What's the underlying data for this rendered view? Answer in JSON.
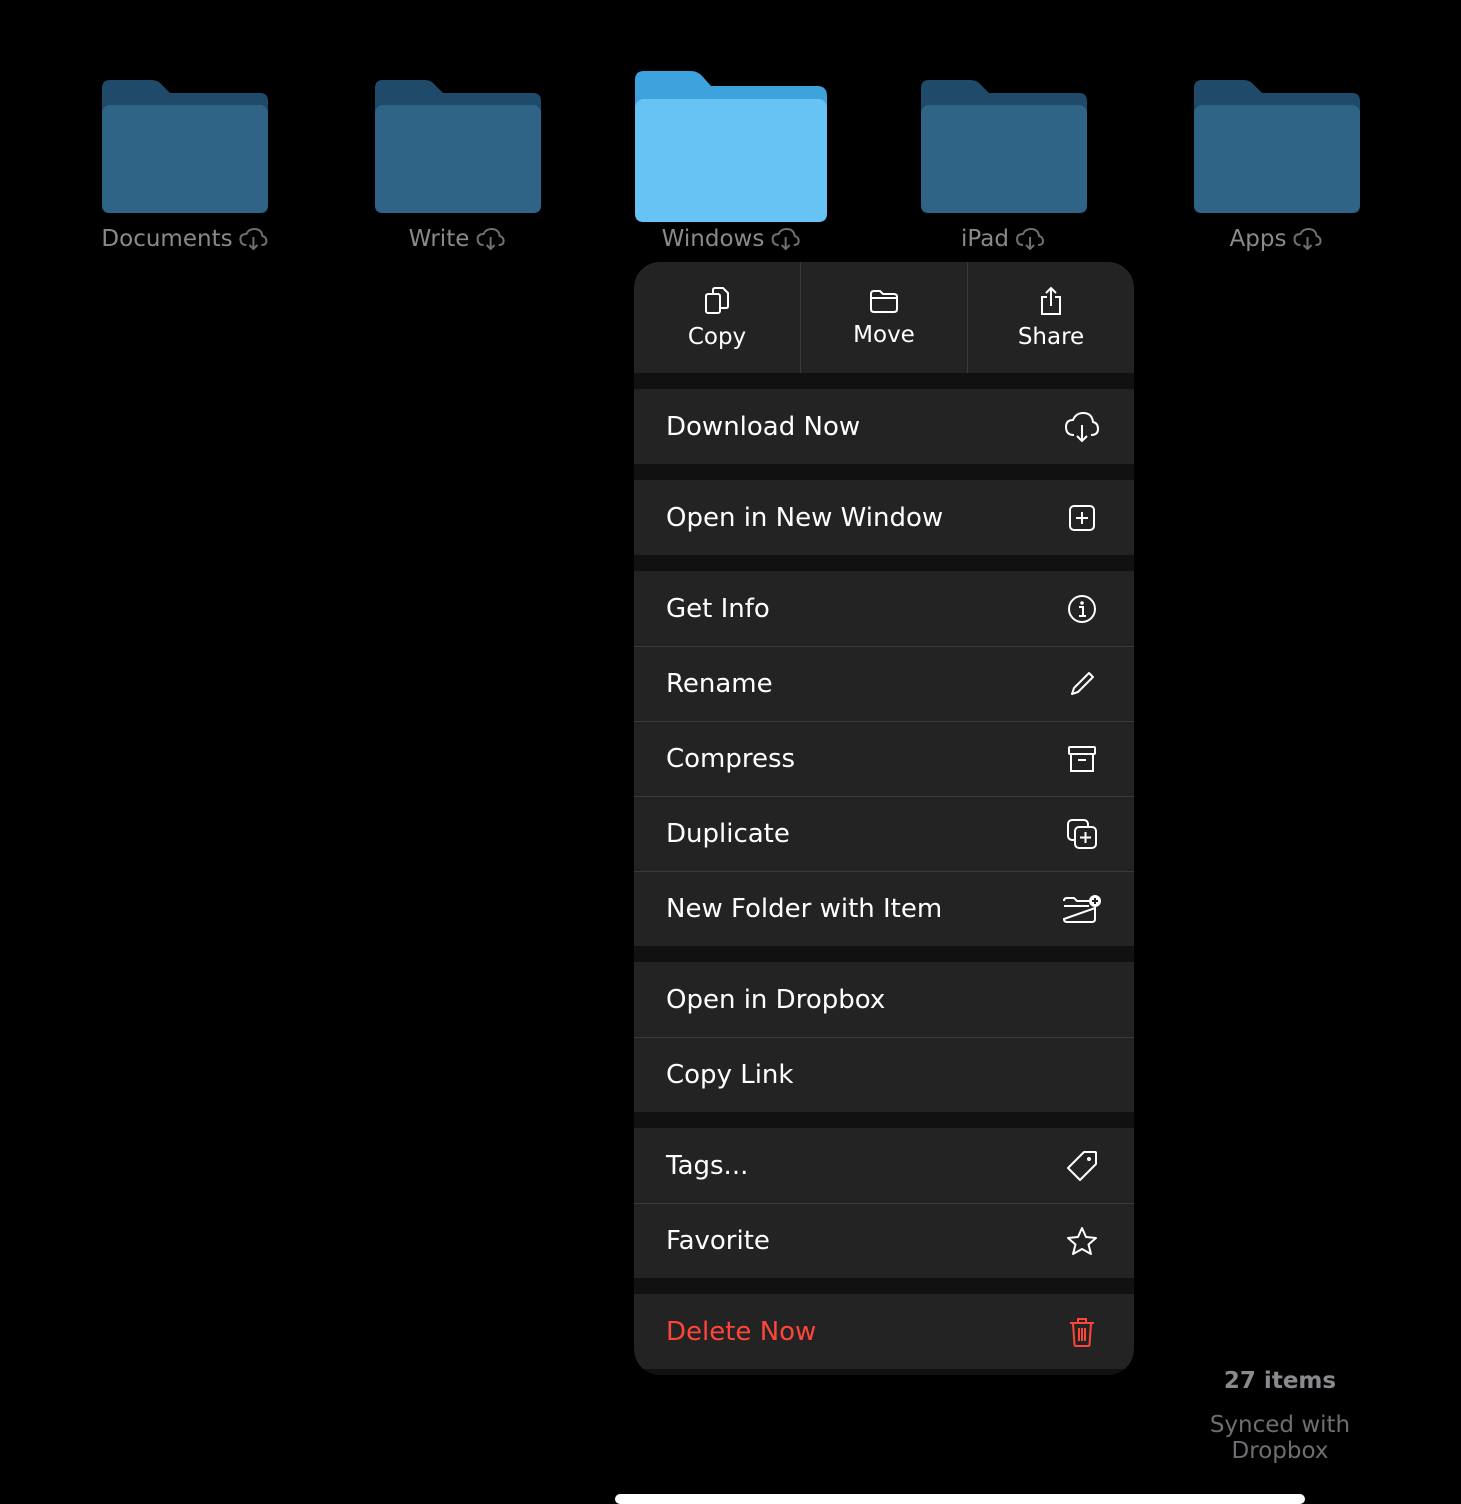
{
  "folders": [
    {
      "name": "Documents",
      "selected": false
    },
    {
      "name": "Write",
      "selected": false
    },
    {
      "name": "Windows",
      "selected": true
    },
    {
      "name": "iPad",
      "selected": false
    },
    {
      "name": "Apps",
      "selected": false
    }
  ],
  "menu": {
    "top_actions": [
      {
        "label": "Copy",
        "icon": "copy-icon"
      },
      {
        "label": "Move",
        "icon": "folder-icon"
      },
      {
        "label": "Share",
        "icon": "share-icon"
      }
    ],
    "groups": [
      [
        {
          "label": "Download Now",
          "icon": "cloud-download-icon"
        }
      ],
      [
        {
          "label": "Open in New Window",
          "icon": "plus-square-icon"
        }
      ],
      [
        {
          "label": "Get Info",
          "icon": "info-icon"
        },
        {
          "label": "Rename",
          "icon": "pencil-icon"
        },
        {
          "label": "Compress",
          "icon": "archive-icon"
        },
        {
          "label": "Duplicate",
          "icon": "duplicate-icon"
        },
        {
          "label": "New Folder with Item",
          "icon": "folder-plus-icon"
        }
      ],
      [
        {
          "label": "Open in Dropbox",
          "icon": ""
        },
        {
          "label": "Copy Link",
          "icon": ""
        }
      ],
      [
        {
          "label": "Tags...",
          "icon": "tag-icon"
        },
        {
          "label": "Favorite",
          "icon": "star-icon"
        }
      ],
      [
        {
          "label": "Delete Now",
          "icon": "trash-icon",
          "destructive": true
        }
      ]
    ]
  },
  "status": {
    "count": "27 items",
    "sync": "Synced with Dropbox"
  },
  "colors": {
    "folder_dim": "#2f5f80",
    "folder_selected": "#5ec0f2",
    "destructive": "#ff453a",
    "menu_bg": "#232323"
  }
}
